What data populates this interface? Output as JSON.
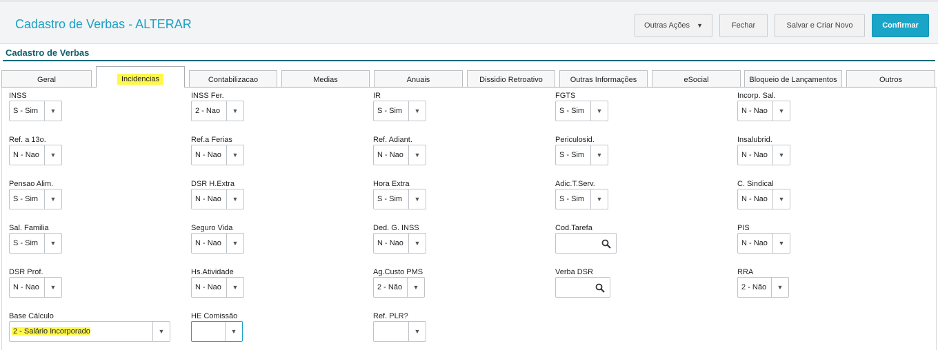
{
  "header": {
    "title": "Cadastro de Verbas - ALTERAR",
    "buttons": {
      "outras_acoes": "Outras Ações",
      "fechar": "Fechar",
      "salvar_novo": "Salvar e Criar Novo",
      "confirmar": "Confirmar"
    }
  },
  "section_title": "Cadastro de Verbas",
  "tabs": [
    "Geral",
    "Incidencias",
    "Contabilizacao",
    "Medias",
    "Anuais",
    "Dissidio Retroativo",
    "Outras Informações",
    "eSocial",
    "Bloqueio de Lançamentos",
    "Outros"
  ],
  "active_tab": "Incidencias",
  "fields": {
    "inss": {
      "label": "INSS",
      "value": "S - Sim"
    },
    "inss_fer": {
      "label": "INSS Fer.",
      "value": "2 - Nao"
    },
    "ir": {
      "label": "IR",
      "value": "S - Sim"
    },
    "fgts": {
      "label": "FGTS",
      "value": "S - Sim"
    },
    "incorp_sal": {
      "label": "Incorp. Sal.",
      "value": "N - Nao"
    },
    "ref_13": {
      "label": "Ref. a 13o.",
      "value": "N - Nao"
    },
    "ref_ferias": {
      "label": "Ref.a Ferias",
      "value": "N - Nao"
    },
    "ref_adiant": {
      "label": "Ref. Adiant.",
      "value": "N - Nao"
    },
    "periculosid": {
      "label": "Periculosid.",
      "value": "S - Sim"
    },
    "insalubrid": {
      "label": "Insalubrid.",
      "value": "N - Nao"
    },
    "pensao_alim": {
      "label": "Pensao Alim.",
      "value": "S - Sim"
    },
    "dsr_hextra": {
      "label": "DSR H.Extra",
      "value": "N - Nao"
    },
    "hora_extra": {
      "label": "Hora Extra",
      "value": "S - Sim"
    },
    "adic_tserv": {
      "label": "Adic.T.Serv.",
      "value": "S - Sim"
    },
    "c_sindical": {
      "label": "C. Sindical",
      "value": "N - Nao"
    },
    "sal_familia": {
      "label": "Sal. Familia",
      "value": "S - Sim"
    },
    "seguro_vida": {
      "label": "Seguro Vida",
      "value": "N - Nao"
    },
    "ded_g_inss": {
      "label": "Ded. G. INSS",
      "value": "N - Nao"
    },
    "cod_tarefa": {
      "label": "Cod.Tarefa",
      "value": ""
    },
    "pis": {
      "label": "PIS",
      "value": "N - Nao"
    },
    "dsr_prof": {
      "label": "DSR Prof.",
      "value": "N - Nao"
    },
    "hs_atividade": {
      "label": "Hs.Atividade",
      "value": "N - Nao"
    },
    "ag_custo_pms": {
      "label": "Ag.Custo PMS",
      "value": "2 - Não"
    },
    "verba_dsr": {
      "label": "Verba DSR",
      "value": ""
    },
    "rra": {
      "label": "RRA",
      "value": "2 - Não"
    },
    "base_calculo": {
      "label": "Base Cálculo",
      "value": "2 - Salário Incorporado"
    },
    "he_comissao": {
      "label": "HE Comissão",
      "value": ""
    },
    "ref_plr": {
      "label": "Ref. PLR?",
      "value": ""
    }
  },
  "colors": {
    "accent": "#1ba1c5",
    "primary_button": "#1aa4c7",
    "section": "#0d5d6b",
    "highlight": "#fff84a"
  }
}
